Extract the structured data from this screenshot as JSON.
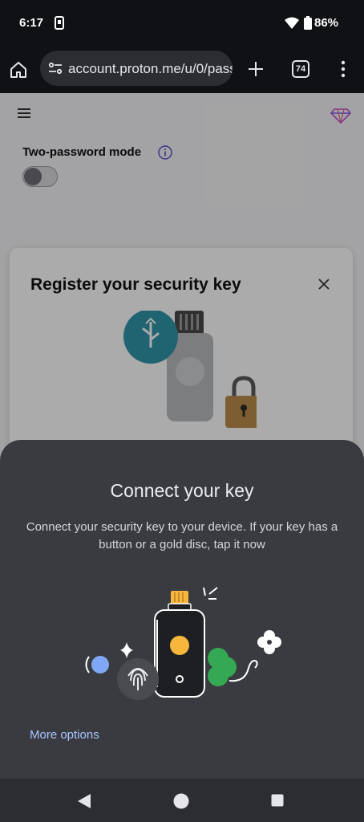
{
  "status_bar": {
    "time": "6:17",
    "battery": "86%"
  },
  "browser": {
    "url": "account.proton.me/u/0/pass",
    "tab_count": "74"
  },
  "page": {
    "two_password_label": "Two-password mode",
    "two_password_enabled": false,
    "dialog_title": "Register your security key"
  },
  "sheet": {
    "title": "Connect your key",
    "description": "Connect your security key to your device. If your key has a button or a gold disc, tap it now",
    "more_options": "More options"
  },
  "colors": {
    "sheet_bg": "#3a3b40",
    "link": "#a9c4ff",
    "key_accent": "#f6b73c",
    "green_blob": "#34a853",
    "blue_dot": "#7fa7f5"
  },
  "icons": {
    "home": "home-icon",
    "site_settings": "tune-icon",
    "new_tab": "plus-icon",
    "overflow": "menu-dots-icon",
    "nav_back": "nav-back-icon",
    "nav_home": "nav-home-icon",
    "nav_recents": "nav-recents-icon"
  }
}
